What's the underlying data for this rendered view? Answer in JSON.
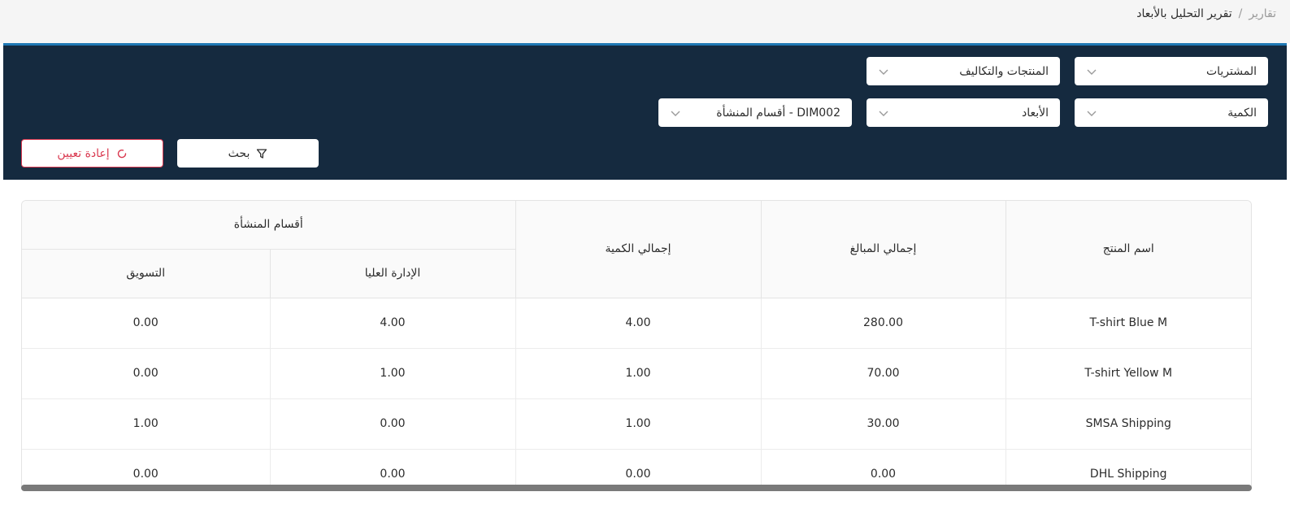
{
  "breadcrumb": {
    "root": "تقارير",
    "separator": "/",
    "current": "تقرير التحليل بالأبعاد"
  },
  "filters": {
    "type": {
      "value": "المشتريات"
    },
    "category": {
      "value": "المنتجات والتكاليف"
    },
    "measure": {
      "value": "الكمية"
    },
    "group_by": {
      "value": "الأبعاد"
    },
    "dimension": {
      "value": "DIM002 - أقسام المنشأة"
    }
  },
  "actions": {
    "search_label": "بحث",
    "reset_label": "إعادة تعيين"
  },
  "table": {
    "headers": {
      "product": "اسم المنتج",
      "total_amount": "إجمالي المبالغ",
      "total_qty": "إجمالي الكمية",
      "group": "أقسام المنشأة",
      "sub1": "الإدارة العليا",
      "sub2": "التسويق"
    },
    "rows": [
      {
        "product": "T-shirt Blue M",
        "total_amount": "280.00",
        "total_qty": "4.00",
        "sub1": "4.00",
        "sub2": "0.00"
      },
      {
        "product": "T-shirt Yellow M",
        "total_amount": "70.00",
        "total_qty": "1.00",
        "sub1": "1.00",
        "sub2": "0.00"
      },
      {
        "product": "SMSA Shipping",
        "total_amount": "30.00",
        "total_qty": "1.00",
        "sub1": "0.00",
        "sub2": "1.00"
      },
      {
        "product": "DHL Shipping",
        "total_amount": "0.00",
        "total_qty": "0.00",
        "sub1": "0.00",
        "sub2": "0.00"
      }
    ]
  },
  "icons": {
    "chevron": "chevron-down-icon",
    "filter": "filter-icon",
    "reset": "refresh-icon"
  },
  "colors": {
    "panel": "#152a3f",
    "accent": "#1f78b4",
    "danger": "#d9384f"
  }
}
